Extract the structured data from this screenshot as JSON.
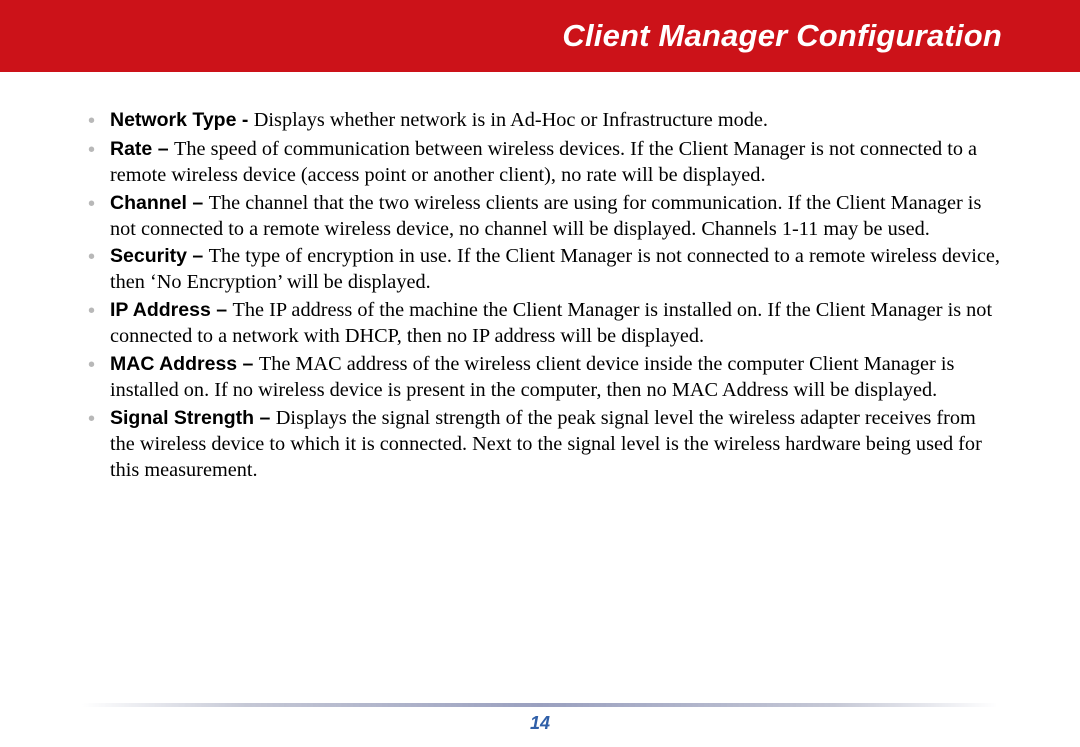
{
  "header": {
    "title": "Client Manager Configuration"
  },
  "items": [
    {
      "term": "Network Type",
      "sep": " - ",
      "desc": "Displays whether network is in Ad-Hoc or Infrastructure mode."
    },
    {
      "term": "Rate",
      "sep": " – ",
      "desc": "The speed of communication between wireless devices.  If the Client Manager is not connected to a remote wireless device (access point or another client), no rate will be displayed."
    },
    {
      "term": "Channel",
      "sep": " – ",
      "desc": "The channel that the two wireless clients are using for communication.  If the Client Manager is not connected to a remote wireless device, no channel will be displayed.  Channels 1-11 may be used."
    },
    {
      "term": "Security",
      "sep": " – ",
      "desc": "The type of encryption in use.  If the Client Manager is not connected to a remote wireless device, then ‘No Encryption’ will be displayed."
    },
    {
      "term": "IP Address",
      "sep": " – ",
      "desc": "The IP address of the machine the Client Manager is installed on. If the Client Manager is not connected to a network with DHCP, then no IP address will be displayed."
    },
    {
      "term": "MAC Address",
      "sep": " – ",
      "desc": "The MAC address of the wireless client device inside the computer Client Manager is installed on. If no wireless device is present in the computer, then no MAC Address will be displayed."
    },
    {
      "term": "Signal Strength",
      "sep": " – ",
      "desc": "Displays the signal strength of the peak signal level the wireless adapter receives from the wireless device to which it is connected.  Next to the signal level is the wireless hardware being used for this measurement."
    }
  ],
  "footer": {
    "page": "14"
  },
  "bulletGlyph": "•"
}
